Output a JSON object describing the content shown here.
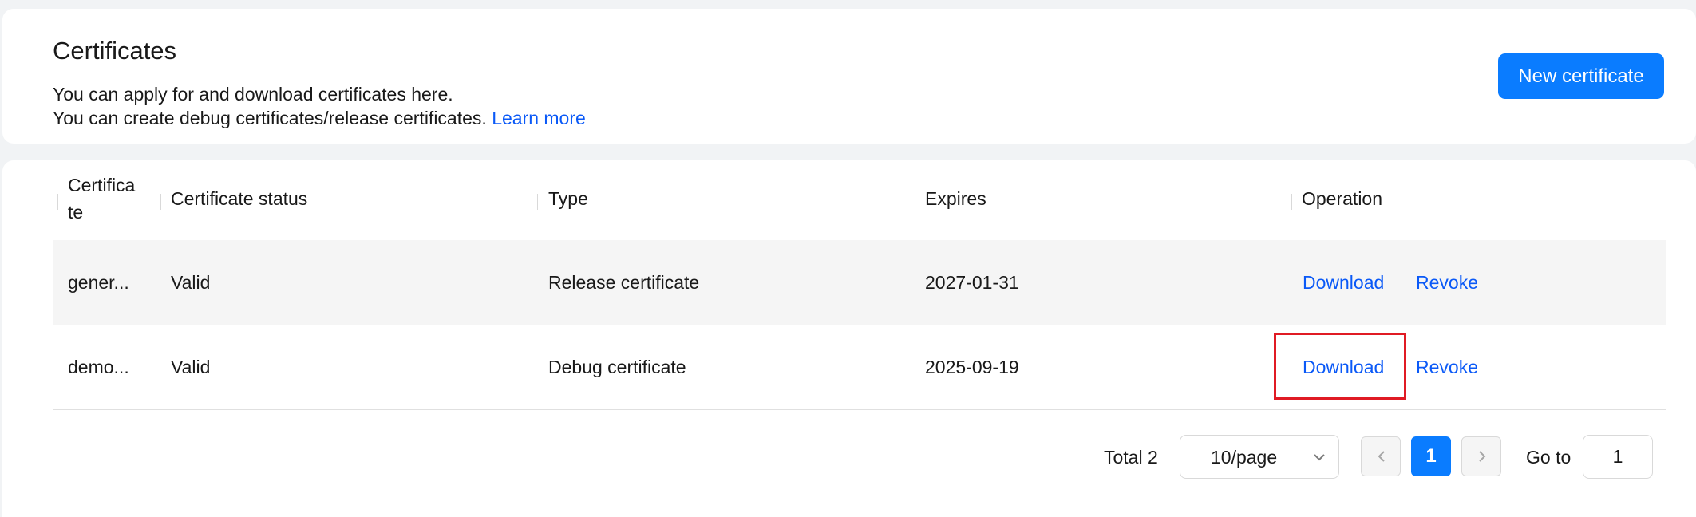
{
  "header": {
    "title": "Certificates",
    "desc1": "You can apply for and download certificates here.",
    "desc2": "You can create debug certificates/release certificates.",
    "learn_more": "Learn more",
    "new_button": "New certificate"
  },
  "table": {
    "columns": {
      "certificate_line1": "Certifica",
      "certificate_line2": "te",
      "status": "Certificate status",
      "type": "Type",
      "expires": "Expires",
      "operation": "Operation"
    },
    "rows": [
      {
        "name": "gener...",
        "status": "Valid",
        "type": "Release certificate",
        "expires": "2027-01-31",
        "download": "Download",
        "revoke": "Revoke"
      },
      {
        "name": "demo...",
        "status": "Valid",
        "type": "Debug certificate",
        "expires": "2025-09-19",
        "download": "Download",
        "revoke": "Revoke"
      }
    ]
  },
  "pagination": {
    "total": "Total 2",
    "page_size": "10/page",
    "current_page": "1",
    "goto_label": "Go to",
    "goto_value": "1"
  },
  "colors": {
    "accent": "#0a7cff",
    "link": "#0a59f7",
    "highlight": "#e01b24"
  },
  "icons": {
    "select": "chevron-down-icon",
    "prev": "chevron-left-icon",
    "next": "chevron-right-icon"
  }
}
